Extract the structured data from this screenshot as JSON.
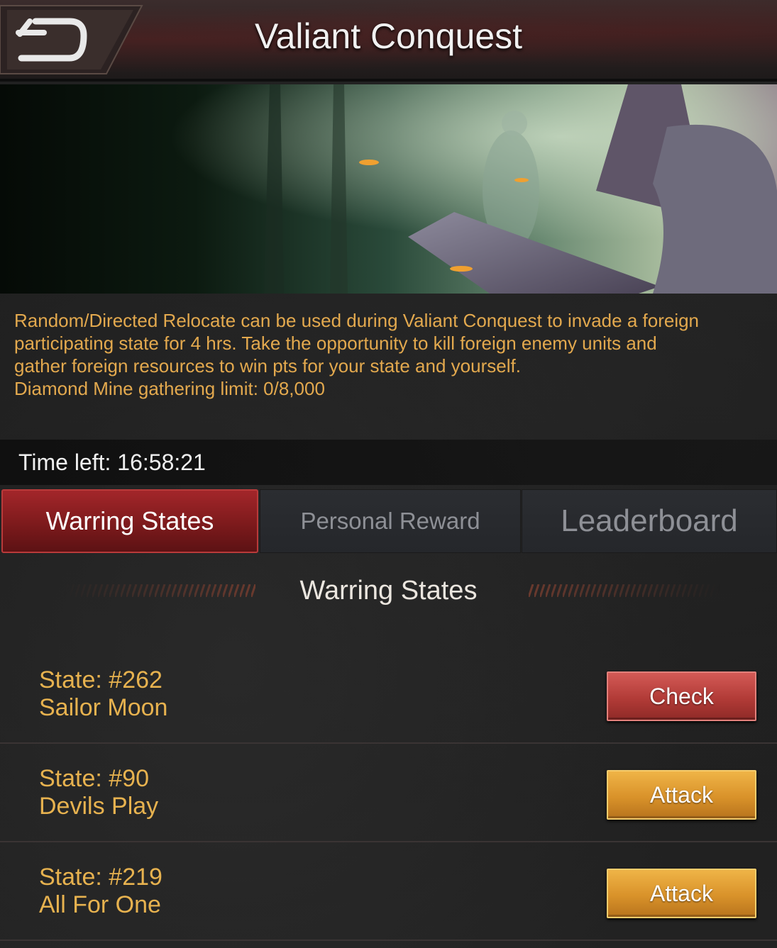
{
  "header": {
    "title": "Valiant Conquest",
    "back_icon": "back-arrow-icon"
  },
  "banner": {
    "description": "Event banner artwork"
  },
  "description": {
    "line1": "Random/Directed Relocate can be used during Valiant Conquest to invade a foreign",
    "line2": "participating state for 4 hrs. Take the opportunity to kill foreign enemy units and",
    "line3": "gather foreign resources to win pts for your state and yourself.",
    "line4": "Diamond Mine gathering limit: 0/8,000"
  },
  "timer": {
    "text": "Time left: 16:58:21"
  },
  "tabs": [
    {
      "label": "Warring States",
      "active": true
    },
    {
      "label": "Personal Reward",
      "active": false
    },
    {
      "label": "Leaderboard",
      "active": false
    }
  ],
  "section": {
    "title": "Warring States"
  },
  "states": [
    {
      "state": "State: #262",
      "name": "Sailor Moon",
      "action": "Check"
    },
    {
      "state": "State: #90",
      "name": "Devils Play",
      "action": "Attack"
    },
    {
      "state": "State: #219",
      "name": "All For One",
      "action": "Attack"
    }
  ],
  "colors": {
    "accent_red": "#a3262a",
    "attack_orange": "#d9922a",
    "description_gold": "#e3a94e"
  }
}
